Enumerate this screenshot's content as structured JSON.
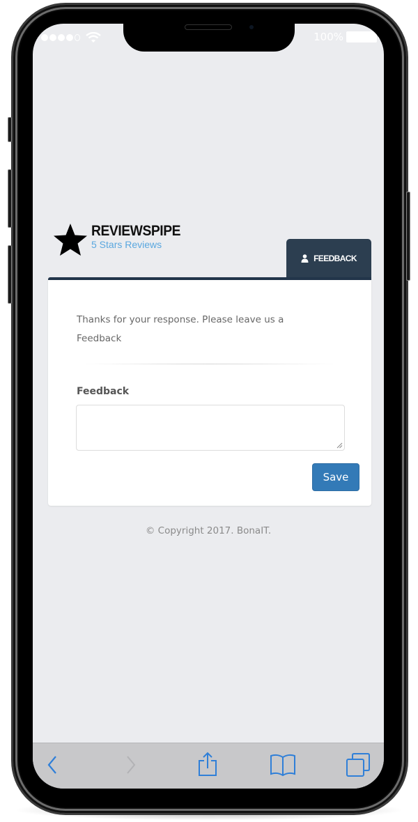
{
  "status_bar": {
    "signal_bars": 4,
    "signal_total": 5,
    "wifi_icon": "wifi-icon",
    "battery_text": "100%",
    "battery_level": 1.0
  },
  "brand": {
    "logo_icon": "star-icon",
    "name": "REVIEWSPIPE",
    "tagline": "5 Stars Reviews"
  },
  "tab": {
    "icon": "user-icon",
    "label": "FEEDBACK"
  },
  "form": {
    "intro_text": "Thanks for your response. Please leave us a Feedback",
    "field_label": "Feedback",
    "field_value": "",
    "field_placeholder": "",
    "save_label": "Save"
  },
  "footer": {
    "copyright": "© Copyright 2017. BonaIT."
  },
  "browser_toolbar": {
    "items": [
      {
        "name": "back-icon",
        "enabled": true
      },
      {
        "name": "forward-icon",
        "enabled": false
      },
      {
        "name": "share-icon",
        "enabled": true
      },
      {
        "name": "bookmarks-icon",
        "enabled": true
      },
      {
        "name": "tabs-icon",
        "enabled": true
      }
    ]
  },
  "colors": {
    "accent": "#337ab7",
    "tab_bg": "#2c3e50",
    "tagline": "#5aa7df",
    "ios_blue": "#2f7fd8",
    "page_bg": "#ebecef"
  }
}
